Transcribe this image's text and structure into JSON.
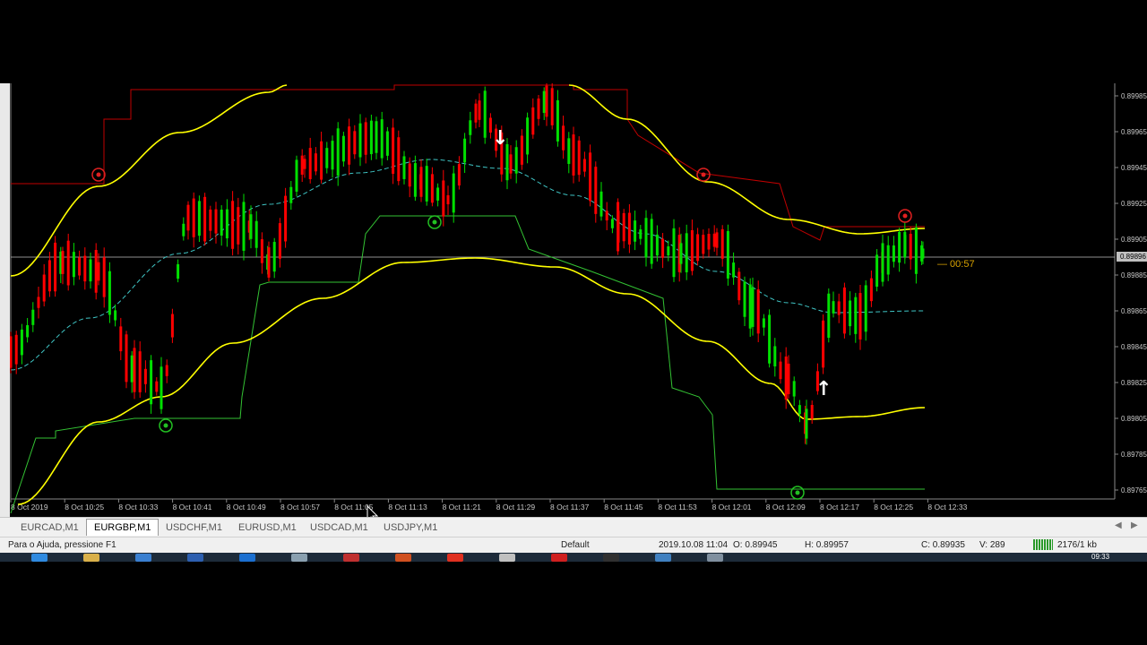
{
  "chart": {
    "symbol": "EURGBP,M1",
    "price_scale": [
      "0.89985",
      "0.89965",
      "0.89945",
      "0.89925",
      "0.89905",
      "0.89885",
      "0.89865",
      "0.89845",
      "0.89825",
      "0.89805",
      "0.89785",
      "0.89765"
    ],
    "current_price_tag": "0.89896",
    "countdown": "00:57",
    "time_labels": [
      "8 Oct 2019",
      "8 Oct 10:25",
      "8 Oct 10:33",
      "8 Oct 10:41",
      "8 Oct 10:49",
      "8 Oct 10:57",
      "8 Oct 11:05",
      "8 Oct 11:13",
      "8 Oct 11:21",
      "8 Oct 11:29",
      "8 Oct 11:37",
      "8 Oct 11:45",
      "8 Oct 11:53",
      "8 Oct 12:01",
      "8 Oct 12:09",
      "8 Oct 12:17",
      "8 Oct 12:25",
      "8 Oct 12:33"
    ],
    "colors": {
      "background": "#000000",
      "bull_candle": "#00e000",
      "bear_candle": "#ff0000",
      "envelope": "#ffff00",
      "upper_channel": "#c00000",
      "lower_channel": "#33c233",
      "ma": "#3fc5c5",
      "bid_line": "#c0c0c0",
      "scale_text": "#c8c8c8"
    }
  },
  "tabs": [
    {
      "label": "EURCAD,M1",
      "active": false
    },
    {
      "label": "EURGBP,M1",
      "active": true
    },
    {
      "label": "USDCHF,M1",
      "active": false
    },
    {
      "label": "EURUSD,M1",
      "active": false
    },
    {
      "label": "USDCAD,M1",
      "active": false
    },
    {
      "label": "USDJPY,M1",
      "active": false
    }
  ],
  "status": {
    "help": "Para o Ajuda, pressione F1",
    "profile": "Default",
    "datetime": "2019.10.08 11:04",
    "open": "O: 0.89945",
    "high": "H: 0.89957",
    "close": "C: 0.89935",
    "volume": "V: 289",
    "traffic": "2176/1 kb"
  },
  "taskbar": {
    "clock": "09:33",
    "icons": [
      "chrome-icon",
      "folder-icon",
      "app-icon",
      "word-icon",
      "outlook-icon",
      "notepad-icon",
      "media-icon",
      "powerpoint-icon",
      "opera-icon",
      "file-icon",
      "pdf-icon",
      "terminal-icon",
      "monitor-icon",
      "network-icon"
    ]
  }
}
